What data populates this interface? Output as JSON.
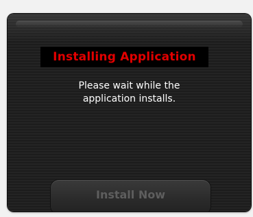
{
  "dialog": {
    "title": "Installing Application",
    "message_lines": [
      "Please wait while the",
      "application installs."
    ],
    "install_button_label": "Install Now",
    "install_button_state": "disabled"
  },
  "colors": {
    "title_text": "#e10000",
    "title_background": "#000000",
    "dialog_background": "#1f1f1f",
    "message_text": "#ffffff",
    "disabled_button_text": "#5e5e5e"
  }
}
